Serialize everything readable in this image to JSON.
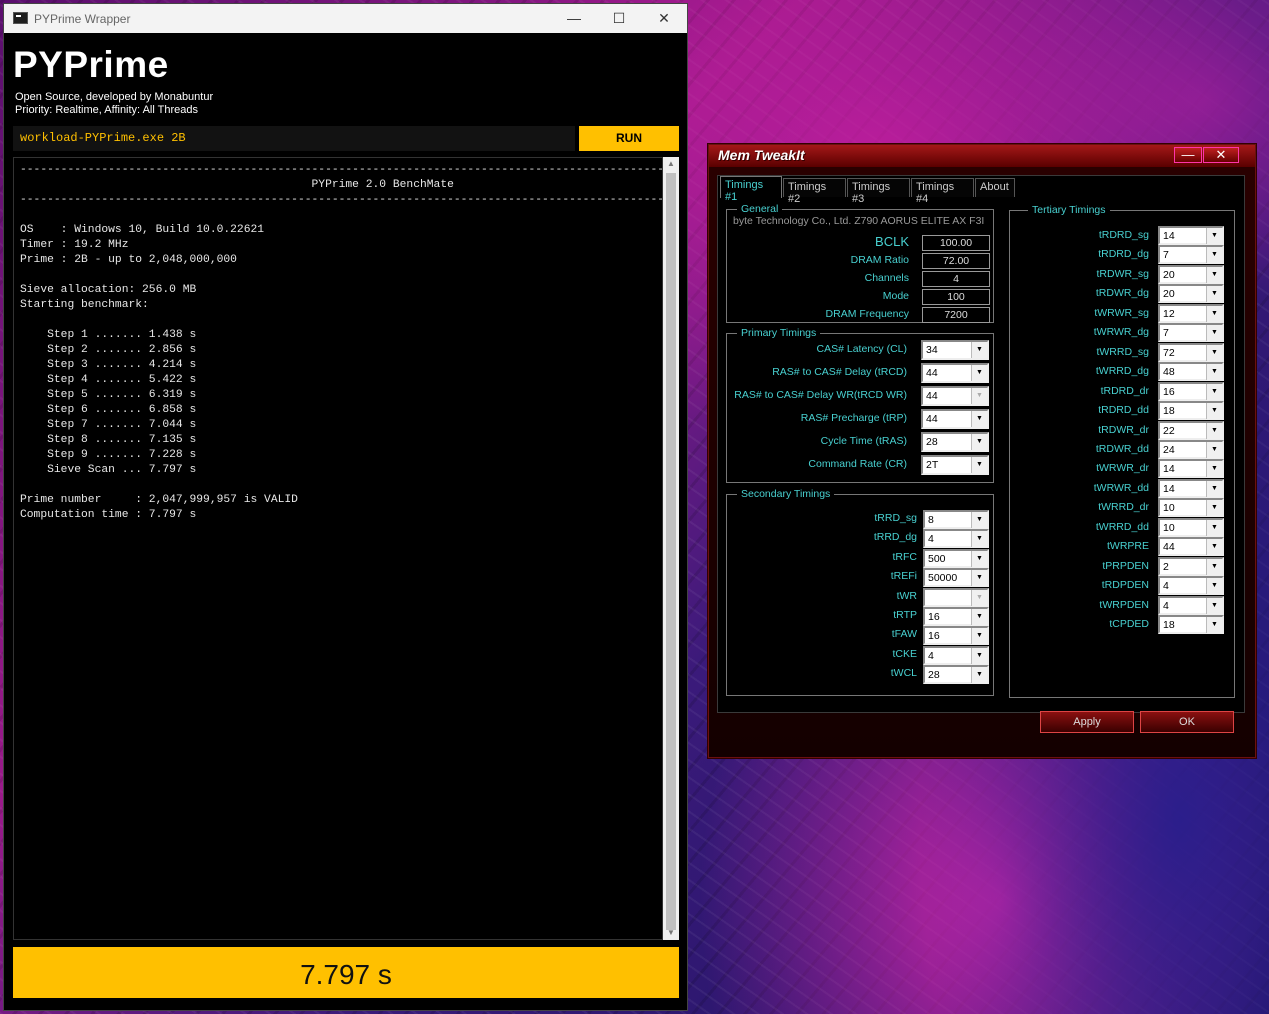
{
  "pyprime": {
    "window_title": "PYPrime Wrapper",
    "controls": {
      "minimize": "—",
      "maximize": "☐",
      "close": "✕"
    },
    "app_title": "PYPrime",
    "subtitle1": "Open Source, developed by Monabuntur",
    "subtitle2": "Priority: Realtime, Affinity: All Threads",
    "command": "workload-PYPrime.exe 2B",
    "run_label": "RUN",
    "console": [
      "--------------------------------------------------------------------------------------------------------------",
      "                                           PYPrime 2.0 BenchMate",
      "--------------------------------------------------------------------------------------------------------------",
      "",
      "OS    : Windows 10, Build 10.0.22621",
      "Timer : 19.2 MHz",
      "Prime : 2B - up to 2,048,000,000",
      "",
      "Sieve allocation: 256.0 MB",
      "Starting benchmark:",
      "",
      "    Step 1 ....... 1.438 s",
      "    Step 2 ....... 2.856 s",
      "    Step 3 ....... 4.214 s",
      "    Step 4 ....... 5.422 s",
      "    Step 5 ....... 6.319 s",
      "    Step 6 ....... 6.858 s",
      "    Step 7 ....... 7.044 s",
      "    Step 8 ....... 7.135 s",
      "    Step 9 ....... 7.228 s",
      "    Sieve Scan ... 7.797 s",
      "",
      "Prime number     : 2,047,999,957 is VALID",
      "Computation time : 7.797 s"
    ],
    "result": "7.797 s"
  },
  "memtweakit": {
    "title": "Mem TweakIt",
    "min_label": "—",
    "close_label": "✕",
    "tabs": [
      "Timings #1",
      "Timings #2",
      "Timings #3",
      "Timings #4",
      "About"
    ],
    "general": {
      "title": "General",
      "board": "byte Technology Co., Ltd. Z790 AORUS ELITE AX F3I",
      "fields": [
        {
          "label": "BCLK",
          "value": "100.00"
        },
        {
          "label": "DRAM Ratio",
          "value": "72.00"
        },
        {
          "label": "Channels",
          "value": "4"
        },
        {
          "label": "Mode",
          "value": "100"
        },
        {
          "label": "DRAM Frequency",
          "value": "7200"
        }
      ]
    },
    "primary": {
      "title": "Primary Timings",
      "fields": [
        {
          "label": "CAS# Latency (CL)",
          "value": "34"
        },
        {
          "label": "RAS# to CAS# Delay (tRCD)",
          "value": "44"
        },
        {
          "label": "RAS# to CAS# Delay WR(tRCD WR)",
          "value": "44"
        },
        {
          "label": "RAS# Precharge (tRP)",
          "value": "44"
        },
        {
          "label": "Cycle Time (tRAS)",
          "value": "28"
        },
        {
          "label": "Command Rate (CR)",
          "value": "2T"
        }
      ]
    },
    "secondary": {
      "title": "Secondary Timings",
      "fields": [
        {
          "label": "tRRD_sg",
          "value": "8"
        },
        {
          "label": "tRRD_dg",
          "value": "4"
        },
        {
          "label": "tRFC",
          "value": "500"
        },
        {
          "label": "tREFi",
          "value": "50000"
        },
        {
          "label": "tWR",
          "value": ""
        },
        {
          "label": "tRTP",
          "value": "16"
        },
        {
          "label": "tFAW",
          "value": "16"
        },
        {
          "label": "tCKE",
          "value": "4"
        },
        {
          "label": "tWCL",
          "value": "28"
        }
      ]
    },
    "tertiary": {
      "title": "Tertiary Timings",
      "fields": [
        {
          "label": "tRDRD_sg",
          "value": "14"
        },
        {
          "label": "tRDRD_dg",
          "value": "7"
        },
        {
          "label": "tRDWR_sg",
          "value": "20"
        },
        {
          "label": "tRDWR_dg",
          "value": "20"
        },
        {
          "label": "tWRWR_sg",
          "value": "12"
        },
        {
          "label": "tWRWR_dg",
          "value": "7"
        },
        {
          "label": "tWRRD_sg",
          "value": "72"
        },
        {
          "label": "tWRRD_dg",
          "value": "48"
        },
        {
          "label": "tRDRD_dr",
          "value": "16"
        },
        {
          "label": "tRDRD_dd",
          "value": "18"
        },
        {
          "label": "tRDWR_dr",
          "value": "22"
        },
        {
          "label": "tRDWR_dd",
          "value": "24"
        },
        {
          "label": "tWRWR_dr",
          "value": "14"
        },
        {
          "label": "tWRWR_dd",
          "value": "14"
        },
        {
          "label": "tWRRD_dr",
          "value": "10"
        },
        {
          "label": "tWRRD_dd",
          "value": "10"
        },
        {
          "label": "tWRPRE",
          "value": "44"
        },
        {
          "label": "tPRPDEN",
          "value": "2"
        },
        {
          "label": "tRDPDEN",
          "value": "4"
        },
        {
          "label": "tWRPDEN",
          "value": "4"
        },
        {
          "label": "tCPDED",
          "value": "18"
        }
      ]
    },
    "apply_label": "Apply",
    "ok_label": "OK"
  }
}
